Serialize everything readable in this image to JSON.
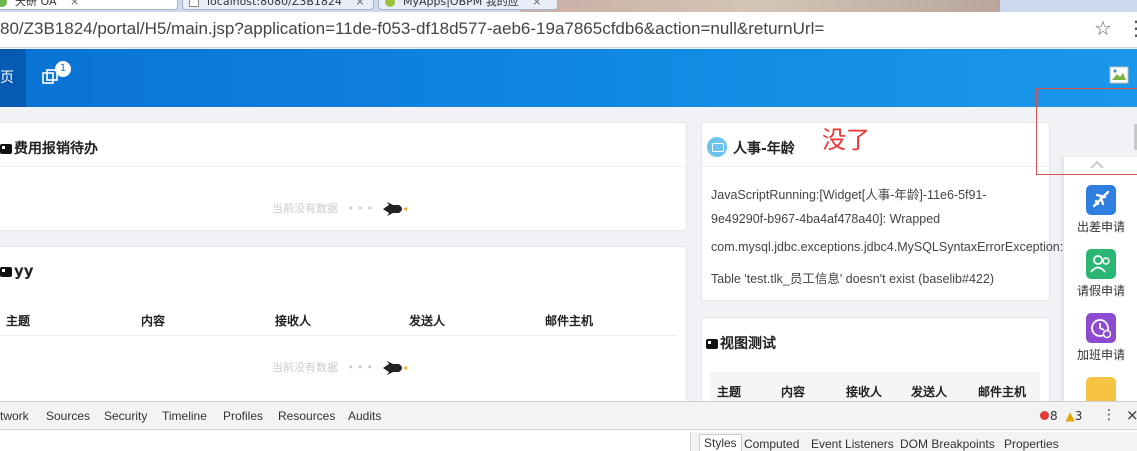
{
  "browser": {
    "tabs": [
      {
        "label": "天研 OA",
        "close": "×"
      },
      {
        "label": "localhost:8080/Z3B1824",
        "close": "×"
      },
      {
        "label": "MyApps|OBPM 我的应",
        "close": "×"
      }
    ],
    "url": "80/Z3B1824/portal/H5/main.jsp?application=11de-f053-df18d577-aeb6-19a7865cfdb6&action=null&returnUrl=",
    "star": "☆",
    "menu": "⋮"
  },
  "header": {
    "home_label": "页",
    "notify_count": "1",
    "colors": {
      "header_blue": "#0a72d4",
      "home_tab": "#065ab1"
    }
  },
  "panels": {
    "expense": {
      "title": "费用报销待办",
      "empty": "当前没有数据"
    },
    "yy": {
      "title": "yy",
      "columns": [
        "主题",
        "内容",
        "接收人",
        "发送人",
        "邮件主机"
      ],
      "empty": "当前没有数据"
    },
    "hr": {
      "title": "人事-年龄",
      "lines": [
        "JavaScriptRunning:[Widget[人事-年龄]-11e6-5f91-",
        "9e49290f-b967-4ba4af478a40]: Wrapped",
        "com.mysql.jdbc.exceptions.jdbc4.MySQLSyntaxErrorException:",
        "Table 'test.tlk_员工信息' doesn't exist (baselib#422)"
      ]
    },
    "view": {
      "title": "视图测试",
      "columns": [
        "主题",
        "内容",
        "接收人",
        "发送人",
        "邮件主机"
      ]
    }
  },
  "annotation": {
    "text": "没了",
    "color": "#e33333"
  },
  "sidebar": {
    "items": [
      {
        "label": "出差申请",
        "color": "#2f7fe0"
      },
      {
        "label": "请假申请",
        "color": "#2bb673"
      },
      {
        "label": "加班申请",
        "color": "#8e4bd1"
      }
    ],
    "more_color": "#f5c242"
  },
  "devtools": {
    "tabs": [
      "twork",
      "Sources",
      "Security",
      "Timeline",
      "Profiles",
      "Resources",
      "Audits"
    ],
    "errors": "8",
    "warnings": "3",
    "kebab": "⋮",
    "close": "×",
    "style_tabs": [
      "Styles",
      "Computed",
      "Event Listeners",
      "DOM Breakpoints",
      "Properties"
    ]
  }
}
